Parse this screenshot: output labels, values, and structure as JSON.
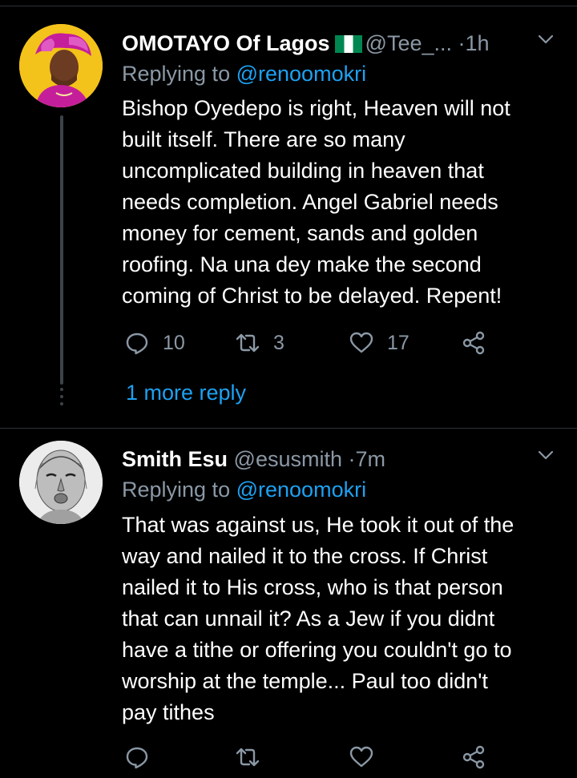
{
  "tweets": [
    {
      "name": "OMOTAYO Of Lagos",
      "handle": "@Tee_...",
      "dot": "·",
      "time": "1h",
      "replying_prefix": "Replying to",
      "replying_to": "@renoomokri",
      "lines": [
        "Bishop Oyedepo is right, Heaven will not",
        "built itself. There are so many",
        "uncomplicated building in heaven that",
        "needs completion. Angel Gabriel needs",
        "money for cement, sands and golden",
        "roofing. Na una dey make the second",
        "coming of Christ to be delayed. Repent!"
      ],
      "reply_count": "10",
      "retweet_count": "3",
      "like_count": "17",
      "more_replies": "1 more reply"
    },
    {
      "name": "Smith Esu",
      "handle": "@esusmith",
      "dot": "·",
      "time": "7m",
      "replying_prefix": "Replying to",
      "replying_to": "@renoomokri",
      "lines": [
        "That was against us, He took it out of the",
        "way and nailed it to the cross. If Christ",
        "nailed it to His cross, who is that person",
        "that can unnail it? As a Jew if you didnt",
        "have a tithe or offering you couldn't go to",
        "worship at the temple... Paul too didn't",
        "pay tithes"
      ]
    }
  ],
  "icons": {
    "reply": "reply-icon",
    "retweet": "retweet-icon",
    "like": "heart-icon",
    "share": "share-icon",
    "menu": "chevron-down-icon"
  },
  "colors": {
    "background": "#000000",
    "secondary_text": "#8b98a5",
    "link": "#1da1f2",
    "divider": "#2f3336"
  }
}
